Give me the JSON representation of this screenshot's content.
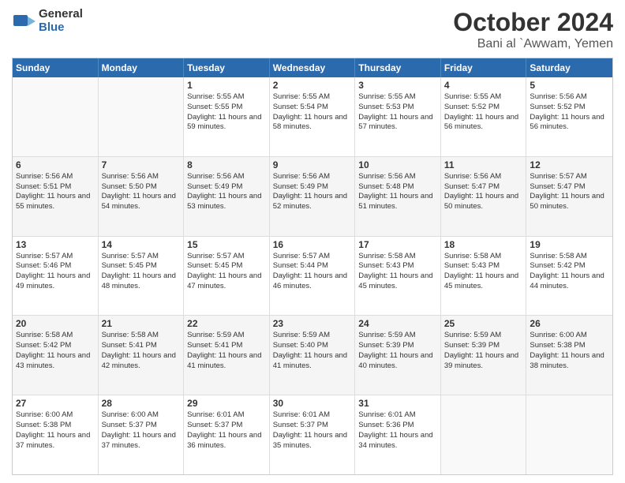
{
  "logo": {
    "general": "General",
    "blue": "Blue"
  },
  "header": {
    "month": "October 2024",
    "location": "Bani al `Awwam, Yemen"
  },
  "weekdays": [
    "Sunday",
    "Monday",
    "Tuesday",
    "Wednesday",
    "Thursday",
    "Friday",
    "Saturday"
  ],
  "rows": [
    {
      "cells": [
        {
          "day": "",
          "info": ""
        },
        {
          "day": "",
          "info": ""
        },
        {
          "day": "1",
          "info": "Sunrise: 5:55 AM\nSunset: 5:55 PM\nDaylight: 11 hours and 59 minutes."
        },
        {
          "day": "2",
          "info": "Sunrise: 5:55 AM\nSunset: 5:54 PM\nDaylight: 11 hours and 58 minutes."
        },
        {
          "day": "3",
          "info": "Sunrise: 5:55 AM\nSunset: 5:53 PM\nDaylight: 11 hours and 57 minutes."
        },
        {
          "day": "4",
          "info": "Sunrise: 5:55 AM\nSunset: 5:52 PM\nDaylight: 11 hours and 56 minutes."
        },
        {
          "day": "5",
          "info": "Sunrise: 5:56 AM\nSunset: 5:52 PM\nDaylight: 11 hours and 56 minutes."
        }
      ]
    },
    {
      "cells": [
        {
          "day": "6",
          "info": "Sunrise: 5:56 AM\nSunset: 5:51 PM\nDaylight: 11 hours and 55 minutes."
        },
        {
          "day": "7",
          "info": "Sunrise: 5:56 AM\nSunset: 5:50 PM\nDaylight: 11 hours and 54 minutes."
        },
        {
          "day": "8",
          "info": "Sunrise: 5:56 AM\nSunset: 5:49 PM\nDaylight: 11 hours and 53 minutes."
        },
        {
          "day": "9",
          "info": "Sunrise: 5:56 AM\nSunset: 5:49 PM\nDaylight: 11 hours and 52 minutes."
        },
        {
          "day": "10",
          "info": "Sunrise: 5:56 AM\nSunset: 5:48 PM\nDaylight: 11 hours and 51 minutes."
        },
        {
          "day": "11",
          "info": "Sunrise: 5:56 AM\nSunset: 5:47 PM\nDaylight: 11 hours and 50 minutes."
        },
        {
          "day": "12",
          "info": "Sunrise: 5:57 AM\nSunset: 5:47 PM\nDaylight: 11 hours and 50 minutes."
        }
      ]
    },
    {
      "cells": [
        {
          "day": "13",
          "info": "Sunrise: 5:57 AM\nSunset: 5:46 PM\nDaylight: 11 hours and 49 minutes."
        },
        {
          "day": "14",
          "info": "Sunrise: 5:57 AM\nSunset: 5:45 PM\nDaylight: 11 hours and 48 minutes."
        },
        {
          "day": "15",
          "info": "Sunrise: 5:57 AM\nSunset: 5:45 PM\nDaylight: 11 hours and 47 minutes."
        },
        {
          "day": "16",
          "info": "Sunrise: 5:57 AM\nSunset: 5:44 PM\nDaylight: 11 hours and 46 minutes."
        },
        {
          "day": "17",
          "info": "Sunrise: 5:58 AM\nSunset: 5:43 PM\nDaylight: 11 hours and 45 minutes."
        },
        {
          "day": "18",
          "info": "Sunrise: 5:58 AM\nSunset: 5:43 PM\nDaylight: 11 hours and 45 minutes."
        },
        {
          "day": "19",
          "info": "Sunrise: 5:58 AM\nSunset: 5:42 PM\nDaylight: 11 hours and 44 minutes."
        }
      ]
    },
    {
      "cells": [
        {
          "day": "20",
          "info": "Sunrise: 5:58 AM\nSunset: 5:42 PM\nDaylight: 11 hours and 43 minutes."
        },
        {
          "day": "21",
          "info": "Sunrise: 5:58 AM\nSunset: 5:41 PM\nDaylight: 11 hours and 42 minutes."
        },
        {
          "day": "22",
          "info": "Sunrise: 5:59 AM\nSunset: 5:41 PM\nDaylight: 11 hours and 41 minutes."
        },
        {
          "day": "23",
          "info": "Sunrise: 5:59 AM\nSunset: 5:40 PM\nDaylight: 11 hours and 41 minutes."
        },
        {
          "day": "24",
          "info": "Sunrise: 5:59 AM\nSunset: 5:39 PM\nDaylight: 11 hours and 40 minutes."
        },
        {
          "day": "25",
          "info": "Sunrise: 5:59 AM\nSunset: 5:39 PM\nDaylight: 11 hours and 39 minutes."
        },
        {
          "day": "26",
          "info": "Sunrise: 6:00 AM\nSunset: 5:38 PM\nDaylight: 11 hours and 38 minutes."
        }
      ]
    },
    {
      "cells": [
        {
          "day": "27",
          "info": "Sunrise: 6:00 AM\nSunset: 5:38 PM\nDaylight: 11 hours and 37 minutes."
        },
        {
          "day": "28",
          "info": "Sunrise: 6:00 AM\nSunset: 5:37 PM\nDaylight: 11 hours and 37 minutes."
        },
        {
          "day": "29",
          "info": "Sunrise: 6:01 AM\nSunset: 5:37 PM\nDaylight: 11 hours and 36 minutes."
        },
        {
          "day": "30",
          "info": "Sunrise: 6:01 AM\nSunset: 5:37 PM\nDaylight: 11 hours and 35 minutes."
        },
        {
          "day": "31",
          "info": "Sunrise: 6:01 AM\nSunset: 5:36 PM\nDaylight: 11 hours and 34 minutes."
        },
        {
          "day": "",
          "info": ""
        },
        {
          "day": "",
          "info": ""
        }
      ]
    }
  ]
}
